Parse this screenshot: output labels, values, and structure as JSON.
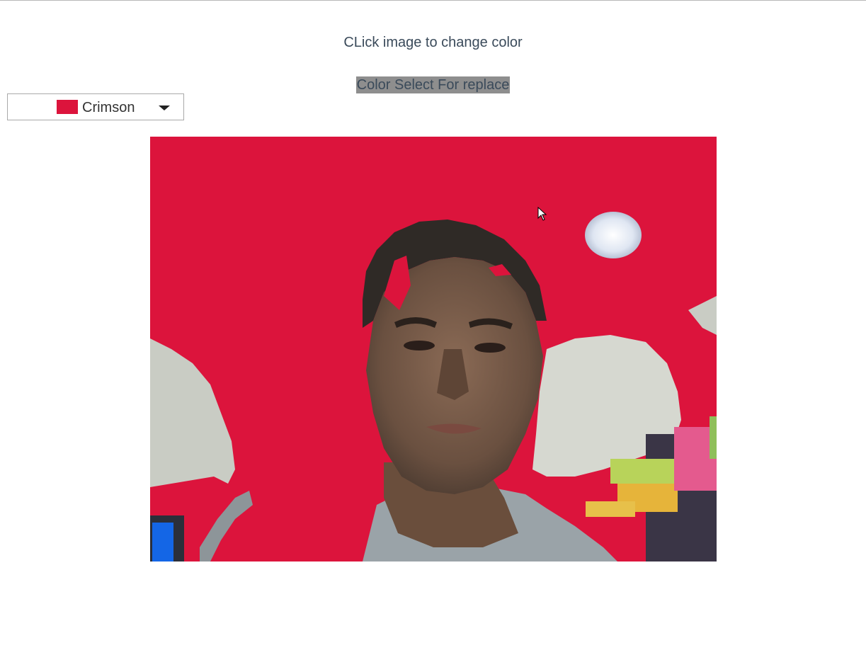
{
  "header": {
    "instruction": "CLick image to change color",
    "picker_label": "Color Select For replace"
  },
  "color_select": {
    "selected_value": "Crimson",
    "selected_color": "#dc143c"
  },
  "image": {
    "replacement_color": "#dc143c"
  },
  "icons": {
    "dropdown": "caret-down-icon",
    "pointer": "mouse-pointer-icon"
  }
}
